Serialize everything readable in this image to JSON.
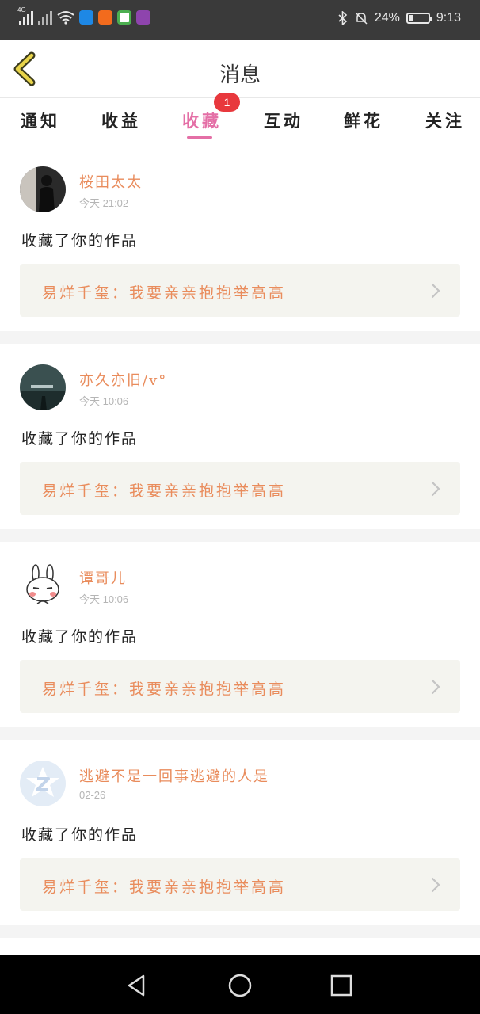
{
  "status_bar": {
    "network": "4G",
    "battery_text": "24%",
    "battery_level": 0.24,
    "time": "9:13",
    "icons": [
      "signal-icon",
      "signal-off-icon",
      "wifi-icon",
      "shield-app-icon",
      "orange-app-icon",
      "circle-app-icon",
      "purple-app-icon",
      "bluetooth-icon",
      "mute-bell-icon",
      "battery-icon"
    ]
  },
  "header": {
    "title": "消息",
    "back_icon": "chevron-left-icon"
  },
  "tabs": [
    {
      "label": "通知"
    },
    {
      "label": "收益"
    },
    {
      "label": "收藏",
      "active": true,
      "badge": "1"
    },
    {
      "label": "互动"
    },
    {
      "label": "鲜花"
    },
    {
      "label": "关注"
    }
  ],
  "colors": {
    "accent": "#e46fa6",
    "name": "#e98c5c",
    "badge": "#e8383d",
    "card_bg": "#f4f4ef"
  },
  "items": [
    {
      "name": "桜田太太",
      "time": "今天 21:02",
      "action": "收藏了你的作品",
      "work": "易烊千玺：我要亲亲抱抱举高高",
      "avatar": "dark-photo-avatar"
    },
    {
      "name": "亦久亦旧/v°",
      "time": "今天 10:06",
      "action": "收藏了你的作品",
      "work": "易烊千玺：我要亲亲抱抱举高高",
      "avatar": "night-photo-avatar"
    },
    {
      "name": "谭哥儿",
      "time": "今天 10:06",
      "action": "收藏了你的作品",
      "work": "易烊千玺：我要亲亲抱抱举高高",
      "avatar": "rabbit-avatar"
    },
    {
      "name": "逃避不是一回事逃避的人是",
      "time": "02-26",
      "action": "收藏了你的作品",
      "work": "易烊千玺：我要亲亲抱抱举高高",
      "avatar": "default-z-avatar"
    }
  ],
  "nav": [
    "back-triangle-icon",
    "home-circle-icon",
    "recents-square-icon"
  ]
}
